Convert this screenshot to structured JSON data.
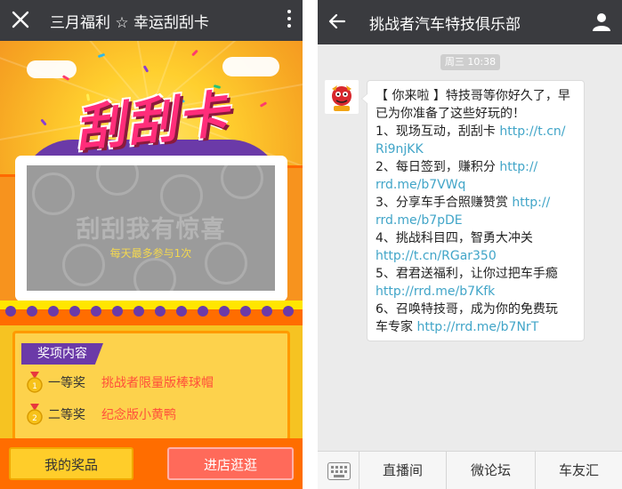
{
  "left_screen": {
    "header": {
      "title": "三月福利 ☆ 幸运刮刮卡",
      "close_icon": "close-icon",
      "more_icon": "more-vertical-icon"
    },
    "banner": {
      "logo_text": "刮刮卡"
    },
    "scratch_card": {
      "main_text": "刮刮我有惊喜",
      "sub_text": "每天最多参与1次"
    },
    "prizes": {
      "tag": "奖项内容",
      "items": [
        {
          "rank": "一等奖",
          "name": "挑战者限量版棒球帽"
        },
        {
          "rank": "二等奖",
          "name": "纪念版小黄鸭"
        }
      ]
    },
    "buttons": {
      "my_prizes": "我的奖品",
      "visit_shop": "进店逛逛"
    },
    "colors": {
      "header_bg": "#3a3b3f",
      "purple": "#6b3aa8",
      "orange": "#ff6d00",
      "yellow": "#ffcd2a",
      "prize_red": "#ff4f3a"
    }
  },
  "right_screen": {
    "header": {
      "title": "挑战者汽车特技俱乐部",
      "back_icon": "back-arrow-icon",
      "user_icon": "user-icon"
    },
    "timestamp": "周三 10:38",
    "message": {
      "lines": [
        {
          "text": "【 你来啦 】特技哥等你好久了，早",
          "link": ""
        },
        {
          "text": "已为你准备了这些好玩的！",
          "link": ""
        },
        {
          "text": "1、现场互动，刮刮卡 ",
          "link": "http://t.cn/"
        },
        {
          "text": "",
          "link": "Ri9njKK"
        },
        {
          "text": "2、每日签到，赚积分 ",
          "link": "http://"
        },
        {
          "text": "",
          "link": "rrd.me/b7VWq"
        },
        {
          "text": "3、分享车手合照赚赞赏 ",
          "link": "http://"
        },
        {
          "text": "",
          "link": "rrd.me/b7pDE"
        },
        {
          "text": "4、挑战科目四，智勇大冲关",
          "link": ""
        },
        {
          "text": "",
          "link": "http://t.cn/RGar350"
        },
        {
          "text": "5、君君送福利，让你过把车手瘾",
          "link": ""
        },
        {
          "text": "",
          "link": "http://rrd.me/b7Kfk"
        },
        {
          "text": "6、召唤特技哥，成为你的免费玩",
          "link": ""
        },
        {
          "text": "车专家 ",
          "link": "http://rrd.me/b7NrT"
        }
      ]
    },
    "bottom_menu": {
      "keyboard_icon": "keyboard-icon",
      "items": [
        "直播间",
        "微论坛",
        "车友汇"
      ]
    },
    "colors": {
      "link": "#41a5c8",
      "background": "#ebebeb"
    }
  }
}
